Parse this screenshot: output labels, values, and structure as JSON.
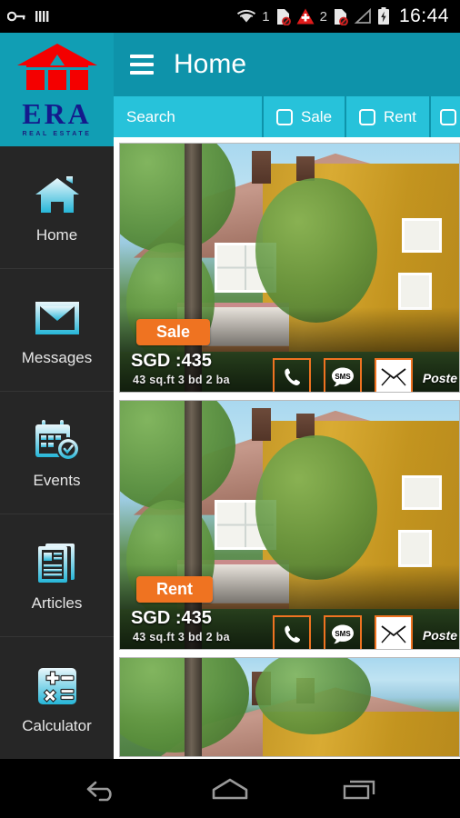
{
  "status_bar": {
    "left_icons": [
      "key-icon",
      "sim-signal-icon"
    ],
    "right_icons": [
      "wifi-icon",
      "sim1-no-card-icon",
      "alert-triangle-icon",
      "sim2-no-card-icon",
      "signal-empty-icon",
      "battery-charging-icon"
    ],
    "sim1_label": "1",
    "sim2_label": "2",
    "clock": "16:44"
  },
  "logo": {
    "brand": "ERA",
    "tagline": "REAL ESTATE",
    "house_color": "#f40000",
    "text_color": "#141a8c",
    "panel_color": "#119eb4"
  },
  "header": {
    "menu_icon": "hamburger-menu-icon",
    "title": "Home",
    "background": "#0e93aa"
  },
  "filter_bar": {
    "background": "#27c2da",
    "search_placeholder": "Search",
    "options": [
      {
        "label": "Sale",
        "checked": false
      },
      {
        "label": "Rent",
        "checked": false
      },
      {
        "label": "",
        "checked": false
      }
    ]
  },
  "sidebar": {
    "background": "#262626",
    "items": [
      {
        "label": "Home",
        "icon": "home-icon",
        "active": true
      },
      {
        "label": "Messages",
        "icon": "envelope-icon",
        "active": false
      },
      {
        "label": "Events",
        "icon": "calendar-check-icon",
        "active": false
      },
      {
        "label": "Articles",
        "icon": "articles-icon",
        "active": false
      },
      {
        "label": "Calculator",
        "icon": "calculator-icon",
        "active": false
      }
    ]
  },
  "listings": [
    {
      "badge": "Sale",
      "badge_color": "#ef7321",
      "price": "SGD :435",
      "meta": "43 sq.ft  3 bd  2 ba",
      "posted": "Poste",
      "actions": [
        {
          "name": "call-button",
          "icon": "phone-icon"
        },
        {
          "name": "sms-button",
          "icon": "sms-icon"
        },
        {
          "name": "email-button",
          "icon": "envelope-icon"
        }
      ]
    },
    {
      "badge": "Rent",
      "badge_color": "#ef7321",
      "price": "SGD :435",
      "meta": "43 sq.ft  3 bd  2 ba",
      "posted": "Poste",
      "actions": [
        {
          "name": "call-button",
          "icon": "phone-icon"
        },
        {
          "name": "sms-button",
          "icon": "sms-icon"
        },
        {
          "name": "email-button",
          "icon": "envelope-icon"
        }
      ]
    },
    {
      "badge": "",
      "badge_color": "#ef7321",
      "price": "",
      "meta": "",
      "posted": "",
      "actions": []
    }
  ],
  "nav_bar": {
    "buttons": [
      {
        "name": "back-button",
        "icon": "back-arrow-icon"
      },
      {
        "name": "home-button",
        "icon": "home-pentagon-icon"
      },
      {
        "name": "recents-button",
        "icon": "recents-icon"
      }
    ]
  }
}
